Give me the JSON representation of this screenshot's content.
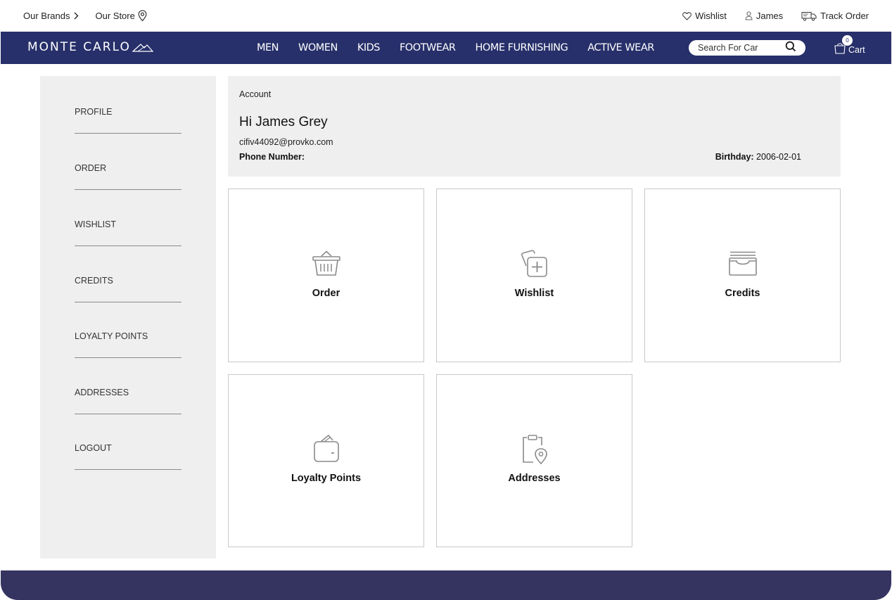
{
  "topbar": {
    "our_brands": "Our Brands",
    "our_store": "Our Store",
    "wishlist": "Wishlist",
    "user": "James",
    "track_order": "Track Order"
  },
  "brand": {
    "logo_text": "MONTE CARLO",
    "color": "#27306a"
  },
  "nav": {
    "items": [
      "MEN",
      "WOMEN",
      "KIDS",
      "FOOTWEAR",
      "HOME FURNISHING",
      "ACTIVE WEAR"
    ]
  },
  "search": {
    "placeholder": "Search For Car"
  },
  "cart": {
    "count": "0",
    "label": "Cart"
  },
  "sidebar": {
    "items": [
      "PROFILE",
      "ORDER",
      "WISHLIST",
      "CREDITS",
      "LOYALTY POINTS",
      "ADDRESSES",
      "LOGOUT"
    ]
  },
  "account": {
    "breadcrumb": "Account",
    "greeting": "Hi James Grey",
    "email": "cifiv44092@provko.com",
    "phone_label": "Phone Number:",
    "phone_value": "",
    "birthday_label": "Birthday:",
    "birthday_value": "2006-02-01"
  },
  "cards": [
    {
      "title": "Order",
      "icon": "basket-icon"
    },
    {
      "title": "Wishlist",
      "icon": "wishlist-add-icon"
    },
    {
      "title": "Credits",
      "icon": "tray-icon"
    },
    {
      "title": "Loyalty Points",
      "icon": "wallet-icon"
    },
    {
      "title": "Addresses",
      "icon": "clipboard-location-icon"
    }
  ],
  "footer": {
    "color": "#353461"
  }
}
